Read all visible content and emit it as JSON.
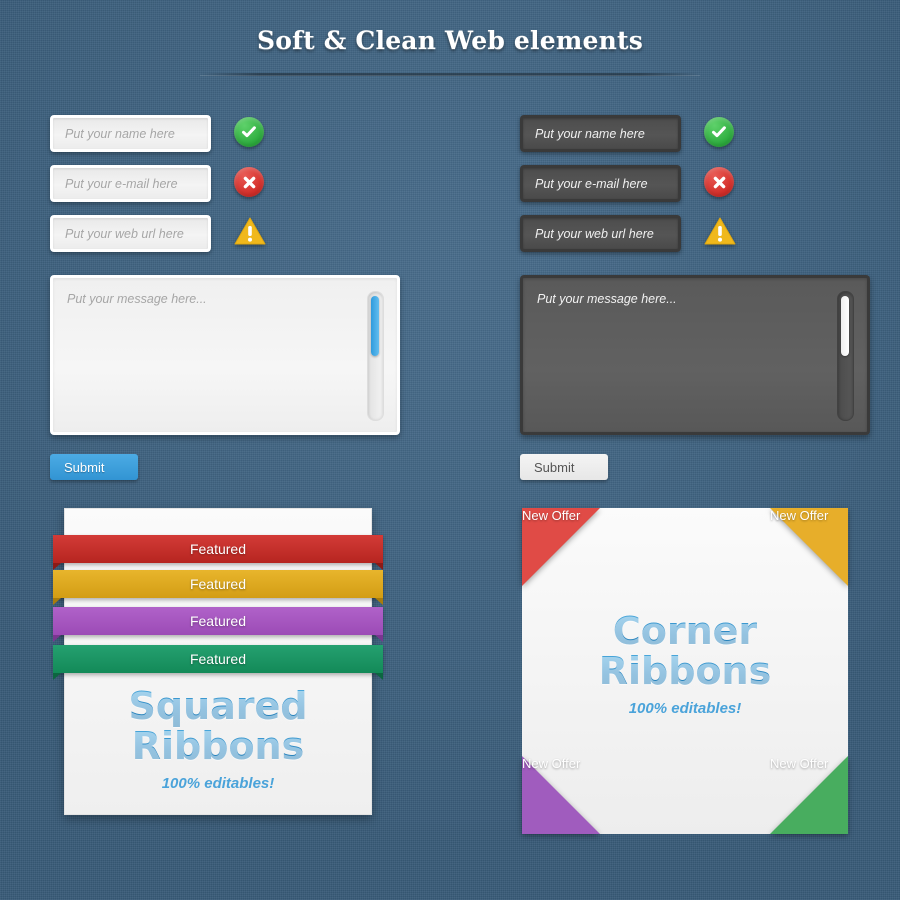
{
  "header": {
    "title": "Soft & Clean Web elements"
  },
  "forms": {
    "light": {
      "name_placeholder": "Put your name here",
      "email_placeholder": "Put your e-mail here",
      "url_placeholder": "Put your web url here",
      "message_placeholder": "Put your message here...",
      "submit_label": "Submit",
      "submit_color": "#3294d3",
      "statuses": [
        "success",
        "error",
        "warning"
      ]
    },
    "dark": {
      "name_placeholder": "Put your name here",
      "email_placeholder": "Put your e-mail here",
      "url_placeholder": "Put your web url here",
      "message_placeholder": "Put your message here...",
      "submit_label": "Submit",
      "submit_color": "#e7e7e7",
      "statuses": [
        "success",
        "error",
        "warning"
      ]
    }
  },
  "squared_ribbons": {
    "title_line1": "Squared",
    "title_line2": "Ribbons",
    "subtitle": "100% editables!",
    "ribbons": [
      {
        "label": "Featured",
        "color": "#c62f2a"
      },
      {
        "label": "Featured",
        "color": "#dca61e"
      },
      {
        "label": "Featured",
        "color": "#a755be"
      },
      {
        "label": "Featured",
        "color": "#1a9564"
      }
    ]
  },
  "corner_ribbons": {
    "title_line1": "Corner",
    "title_line2": "Ribbons",
    "subtitle": "100% editables!",
    "corners": [
      {
        "position": "top-left",
        "label": "New Offer",
        "color": "#e04b46"
      },
      {
        "position": "top-right",
        "label": "New Offer",
        "color": "#e7ae2a"
      },
      {
        "position": "bottom-left",
        "label": "New Offer",
        "color": "#a05cbe"
      },
      {
        "position": "bottom-right",
        "label": "New Offer",
        "color": "#48ad5f"
      }
    ]
  },
  "theme": {
    "background": "#3f6585",
    "accent_blue": "#3294d3",
    "heading_blue": "#2a87c2"
  }
}
